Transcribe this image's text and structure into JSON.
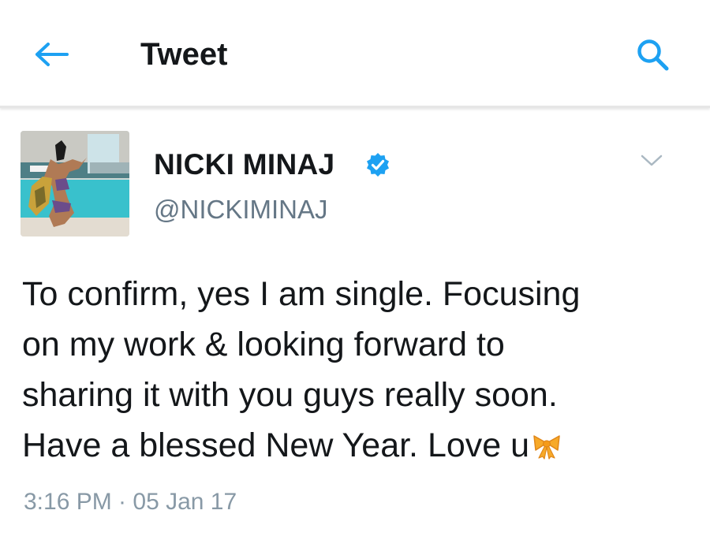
{
  "header": {
    "title": "Tweet",
    "back_icon": "arrow-left-icon",
    "search_icon": "search-icon"
  },
  "author": {
    "name": "NICKI MINAJ",
    "handle": "@NICKIMINAJ",
    "verified": true,
    "verified_icon": "verified-badge-icon"
  },
  "tweet": {
    "lines": [
      "To confirm, yes I am single. Focusing",
      "on my work & looking forward to",
      "sharing it with you guys really soon.",
      "Have a blessed New Year. Love u"
    ],
    "trailing_emoji": "ribbon-bow-icon",
    "timestamp": "3:16 PM · 05 Jan 17"
  },
  "colors": {
    "accent": "#1da1f2",
    "text_primary": "#14171a",
    "text_secondary": "#657786",
    "timestamp": "#8899a6",
    "divider": "#e6e6e6"
  }
}
